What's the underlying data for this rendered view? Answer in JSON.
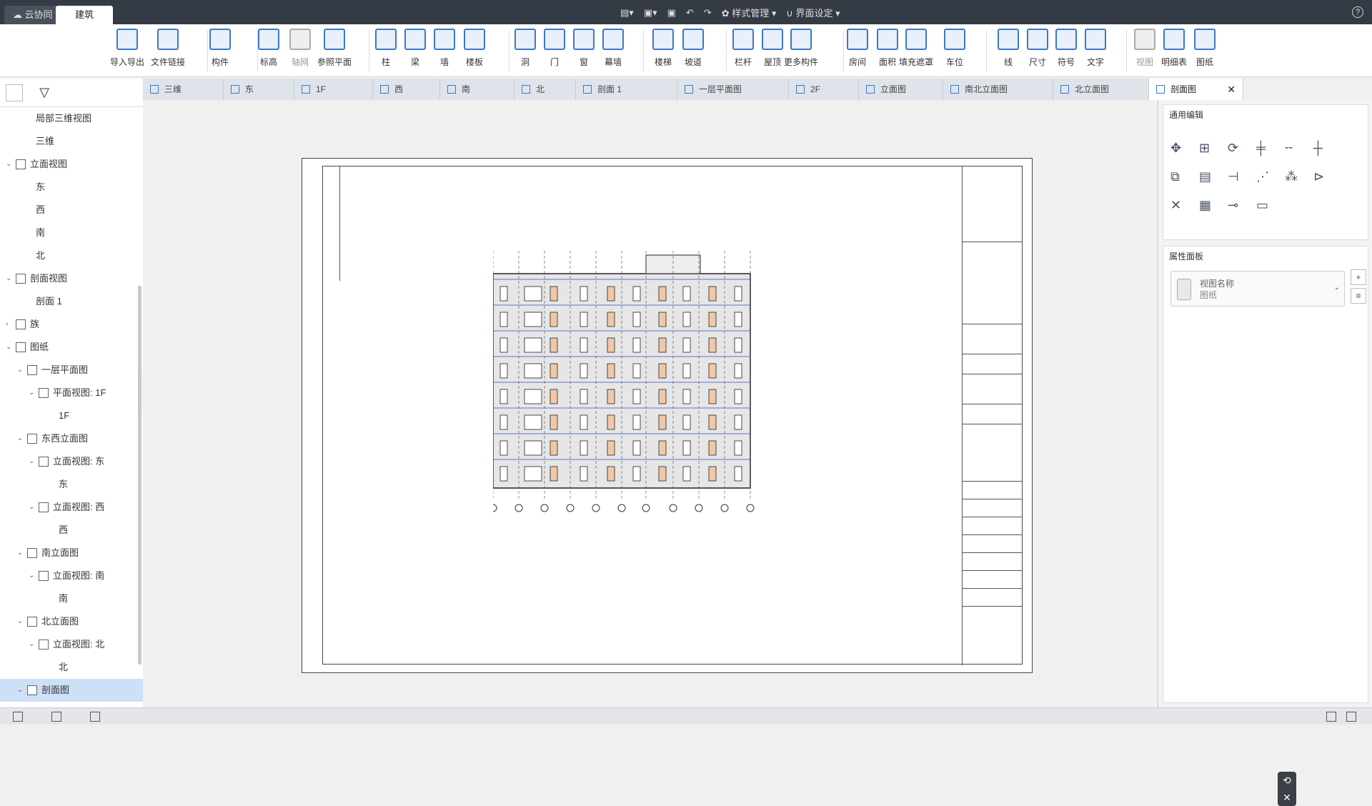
{
  "topbar": {
    "tab_cloud": "云协同",
    "tab_arch": "建筑",
    "style_mgmt": "样式管理",
    "ui_settings": "界面设定",
    "help": "?"
  },
  "ribbon": [
    {
      "label": "导入导出",
      "icon": "cad-import-icon"
    },
    {
      "label": "文件链接",
      "icon": "link-icon"
    },
    {
      "label": "构件",
      "icon": "component-icon"
    },
    {
      "label": "标高",
      "icon": "level-icon"
    },
    {
      "label": "轴网",
      "icon": "grid-icon",
      "dim": true
    },
    {
      "label": "参照平面",
      "icon": "ref-plane-icon"
    },
    {
      "label": "柱",
      "icon": "column-icon"
    },
    {
      "label": "梁",
      "icon": "beam-icon"
    },
    {
      "label": "墙",
      "icon": "wall-icon"
    },
    {
      "label": "楼板",
      "icon": "slab-icon"
    },
    {
      "label": "洞",
      "icon": "opening-icon"
    },
    {
      "label": "门",
      "icon": "door-icon"
    },
    {
      "label": "窗",
      "icon": "window-icon"
    },
    {
      "label": "幕墙",
      "icon": "curtain-wall-icon"
    },
    {
      "label": "楼梯",
      "icon": "stair-icon"
    },
    {
      "label": "坡道",
      "icon": "ramp-icon"
    },
    {
      "label": "栏杆",
      "icon": "railing-icon"
    },
    {
      "label": "屋顶",
      "icon": "roof-icon"
    },
    {
      "label": "更多构件",
      "icon": "more-components-icon"
    },
    {
      "label": "房间",
      "icon": "room-icon"
    },
    {
      "label": "面积",
      "icon": "area-icon"
    },
    {
      "label": "填充遮罩",
      "icon": "fill-mask-icon"
    },
    {
      "label": "车位",
      "icon": "parking-icon"
    },
    {
      "label": "线",
      "icon": "line-icon"
    },
    {
      "label": "尺寸",
      "icon": "dimension-icon"
    },
    {
      "label": "符号",
      "icon": "symbol-icon"
    },
    {
      "label": "文字",
      "icon": "text-icon"
    },
    {
      "label": "视图",
      "icon": "view-icon",
      "dim": true
    },
    {
      "label": "明细表",
      "icon": "schedule-icon"
    },
    {
      "label": "图纸",
      "icon": "sheet-icon"
    }
  ],
  "tree": [
    {
      "label": "局部三维视图",
      "level": 1,
      "icon": false,
      "arrow": ""
    },
    {
      "label": "三维",
      "level": 1,
      "icon": false,
      "arrow": ""
    },
    {
      "label": "立面视图",
      "level": 0,
      "icon": true,
      "arrow": "v"
    },
    {
      "label": "东",
      "level": 1,
      "icon": false,
      "arrow": ""
    },
    {
      "label": "西",
      "level": 1,
      "icon": false,
      "arrow": ""
    },
    {
      "label": "南",
      "level": 1,
      "icon": false,
      "arrow": ""
    },
    {
      "label": "北",
      "level": 1,
      "icon": false,
      "arrow": ""
    },
    {
      "label": "剖面视图",
      "level": 0,
      "icon": true,
      "arrow": "v"
    },
    {
      "label": "剖面 1",
      "level": 1,
      "icon": false,
      "arrow": ""
    },
    {
      "label": "族",
      "level": 0,
      "icon": true,
      "arrow": ">"
    },
    {
      "label": "图纸",
      "level": 0,
      "icon": true,
      "arrow": "v"
    },
    {
      "label": "一层平面图",
      "level": 1,
      "icon": true,
      "arrow": "v"
    },
    {
      "label": "平面视图: 1F",
      "level": 2,
      "icon": true,
      "arrow": "v"
    },
    {
      "label": "1F",
      "level": 3,
      "icon": false,
      "arrow": ""
    },
    {
      "label": "东西立面图",
      "level": 1,
      "icon": true,
      "arrow": "v"
    },
    {
      "label": "立面视图: 东",
      "level": 2,
      "icon": true,
      "arrow": "v"
    },
    {
      "label": "东",
      "level": 3,
      "icon": false,
      "arrow": ""
    },
    {
      "label": "立面视图: 西",
      "level": 2,
      "icon": true,
      "arrow": "v"
    },
    {
      "label": "西",
      "level": 3,
      "icon": false,
      "arrow": ""
    },
    {
      "label": "南立面图",
      "level": 1,
      "icon": true,
      "arrow": "v"
    },
    {
      "label": "立面视图: 南",
      "level": 2,
      "icon": true,
      "arrow": "v"
    },
    {
      "label": "南",
      "level": 3,
      "icon": false,
      "arrow": ""
    },
    {
      "label": "北立面图",
      "level": 1,
      "icon": true,
      "arrow": "v"
    },
    {
      "label": "立面视图: 北",
      "level": 2,
      "icon": true,
      "arrow": "v"
    },
    {
      "label": "北",
      "level": 3,
      "icon": false,
      "arrow": ""
    },
    {
      "label": "剖面图",
      "level": 1,
      "icon": true,
      "arrow": "v",
      "selected": true
    }
  ],
  "doc_tabs": [
    {
      "label": "三维"
    },
    {
      "label": "东"
    },
    {
      "label": "1F"
    },
    {
      "label": "西"
    },
    {
      "label": "南"
    },
    {
      "label": "北"
    },
    {
      "label": "剖面 1"
    },
    {
      "label": "一层平面图"
    },
    {
      "label": "2F"
    },
    {
      "label": "立面图"
    },
    {
      "label": "南北立面图"
    },
    {
      "label": "北立面图"
    },
    {
      "label": "剖面图",
      "active": true
    }
  ],
  "props": {
    "edit_title": "通用编辑",
    "prop_title": "属性面板",
    "view_name_label": "视图名称",
    "view_name_value": "图纸",
    "add": "+",
    "list": "≡"
  },
  "colors": {
    "topbar": "#353b45",
    "accent": "#3d78c4",
    "selection": "#cde0f7"
  }
}
